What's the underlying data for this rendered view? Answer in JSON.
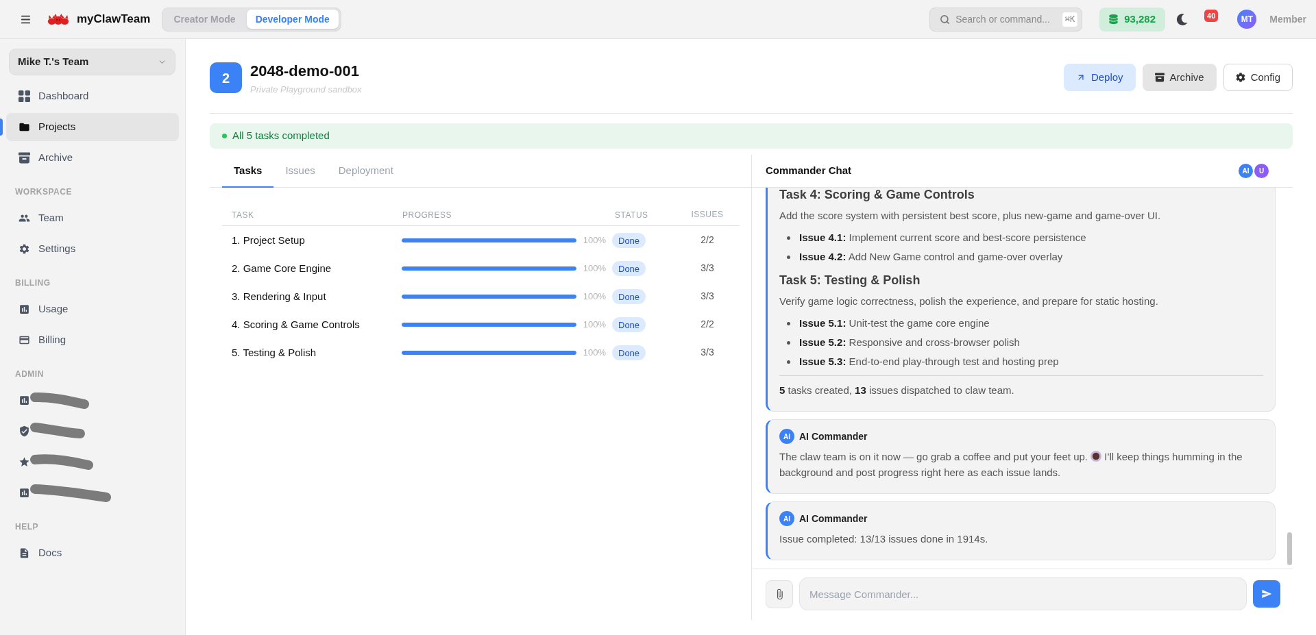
{
  "top_bar": {
    "brand": "myClawTeam",
    "modes": [
      {
        "label": "Creator Mode",
        "selected": false
      },
      {
        "label": "Developer Mode",
        "selected": true
      }
    ],
    "search": {
      "placeholder": "Search or command...",
      "shortcut": "⌘K"
    },
    "credits": "93,282",
    "notifications": "40",
    "user": {
      "initials": "MT",
      "role": "Member"
    }
  },
  "sidebar": {
    "team": "Mike T.'s Team",
    "sections": [
      {
        "items": [
          {
            "kind": "link",
            "label": "Dashboard",
            "selected": false
          },
          {
            "kind": "link",
            "label": "Projects",
            "selected": true
          },
          {
            "kind": "link",
            "label": "Archive",
            "selected": false
          }
        ]
      },
      {
        "title": "WORKSPACE",
        "items": [
          {
            "kind": "link",
            "label": "Team",
            "selected": false
          },
          {
            "kind": "link",
            "label": "Settings",
            "selected": false
          }
        ]
      },
      {
        "title": "BILLING",
        "items": [
          {
            "kind": "link",
            "label": "Usage",
            "selected": false
          },
          {
            "kind": "link",
            "label": "Billing",
            "selected": false
          }
        ]
      },
      {
        "title": "ADMIN",
        "items": [
          {
            "kind": "redacted",
            "selected": false
          },
          {
            "kind": "redacted",
            "selected": false
          },
          {
            "kind": "redacted",
            "selected": false
          },
          {
            "kind": "redacted",
            "selected": false
          }
        ]
      },
      {
        "title": "HELP",
        "items": [
          {
            "kind": "link",
            "label": "Docs",
            "selected": false
          }
        ]
      }
    ]
  },
  "project": {
    "number": "2",
    "name": "2048-demo-001",
    "description": "Private Playground sandbox",
    "actions": [
      {
        "kind": "primary",
        "label": "Deploy"
      },
      {
        "kind": "secondary",
        "label": "Archive"
      },
      {
        "kind": "outline",
        "label": "Config"
      }
    ]
  },
  "banner": {
    "text": "All 5 tasks completed"
  },
  "tabs": [
    {
      "label": "Tasks",
      "selected": true
    },
    {
      "label": "Issues",
      "selected": false
    },
    {
      "label": "Deployment",
      "selected": false
    }
  ],
  "table": {
    "columns": [
      "TASK",
      "PROGRESS",
      "STATUS",
      "ISSUES"
    ],
    "rows": [
      {
        "task": "1. Project Setup",
        "level": 1,
        "percent": "100%",
        "status": "Done",
        "issues": "2/2"
      },
      {
        "task": "2. Game Core Engine",
        "level": 1,
        "percent": "100%",
        "status": "Done",
        "issues": "3/3"
      },
      {
        "task": "3. Rendering & Input",
        "level": 1,
        "percent": "100%",
        "status": "Done",
        "issues": "3/3"
      },
      {
        "task": "4. Scoring & Game Controls",
        "level": 1,
        "percent": "100%",
        "status": "Done",
        "issues": "2/2"
      },
      {
        "task": "5. Testing & Polish",
        "level": 1,
        "percent": "100%",
        "status": "Done",
        "issues": "3/3"
      }
    ]
  },
  "chat": {
    "title": "Commander Chat",
    "participants": [
      {
        "initials": "AI",
        "color": "#3b82f6"
      },
      {
        "initials": "U",
        "color": "#8b5cf6"
      }
    ],
    "messages": [
      {
        "blocks": [
          {
            "kind": "heading",
            "text": "Task 4: Scoring & Game Controls"
          },
          {
            "kind": "paragraph",
            "text": "Add the score system with persistent best score, plus new-game and game-over UI."
          },
          {
            "kind": "bullet",
            "text": "**Issue 4.1:** Implement current score and best-score persistence"
          },
          {
            "kind": "bullet",
            "text": "**Issue 4.2:** Add New Game control and game-over overlay"
          },
          {
            "kind": "heading",
            "text": "Task 5: Testing & Polish"
          },
          {
            "kind": "paragraph",
            "text": "Verify game logic correctness, polish the experience, and prepare for static hosting."
          },
          {
            "kind": "bullet",
            "text": "**Issue 5.1:** Unit-test the game core engine"
          },
          {
            "kind": "bullet",
            "text": "**Issue 5.2:** Responsive and cross-browser polish"
          },
          {
            "kind": "bullet",
            "text": "**Issue 5.3:** End-to-end play-through test and hosting prep"
          },
          {
            "kind": "rule"
          },
          {
            "kind": "paragraph",
            "text": "**5** tasks created, **13** issues dispatched to claw team."
          }
        ]
      },
      {
        "author": "AI Commander",
        "avatar": "AI",
        "blocks": [
          {
            "kind": "paragraph_with_emoji",
            "before": "The claw team is on it now — go grab a coffee and put your feet up.",
            "after": "I'll keep things humming in the background and post progress right here as each issue lands."
          }
        ]
      },
      {
        "author": "AI Commander",
        "avatar": "AI",
        "blocks": [
          {
            "kind": "paragraph",
            "text": "Issue completed: 13/13 issues done in 1914s."
          }
        ]
      }
    ],
    "composer": {
      "placeholder": "Message Commander..."
    }
  }
}
